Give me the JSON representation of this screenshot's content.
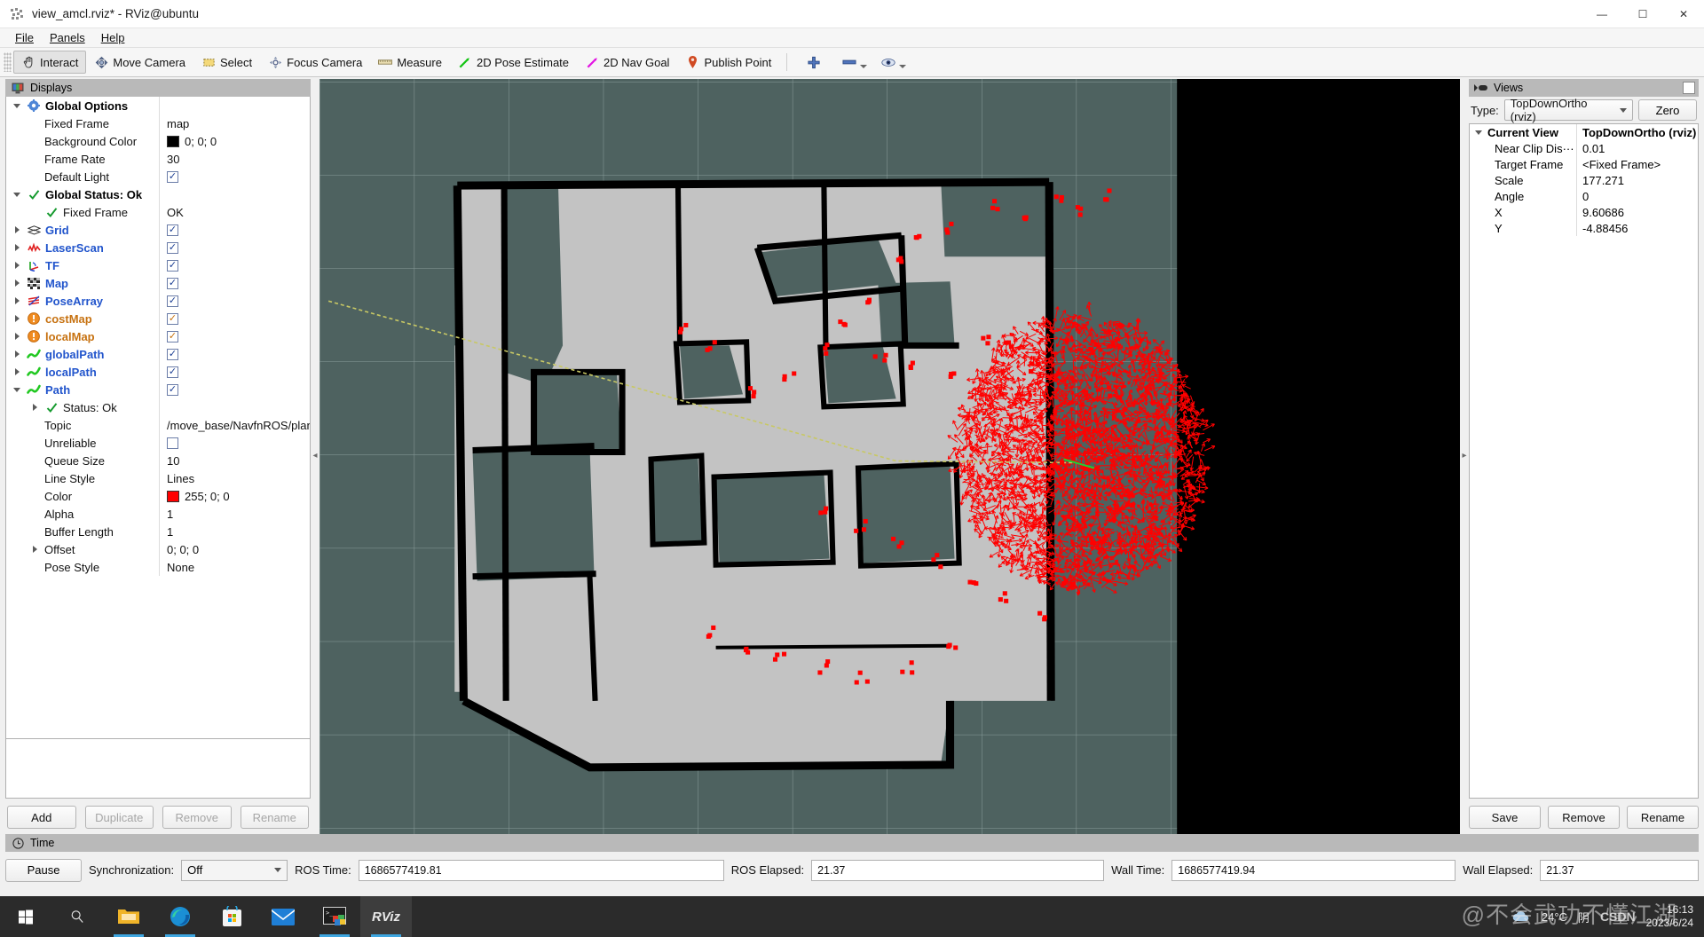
{
  "window": {
    "title": "view_amcl.rviz* - RViz@ubuntu",
    "icon": "rviz-app-icon",
    "minimize": "—",
    "maximize": "☐",
    "close": "✕"
  },
  "menu": {
    "items": [
      "File",
      "Panels",
      "Help"
    ]
  },
  "toolbar": {
    "buttons": [
      {
        "label": "Interact",
        "icon": "hand-cursor-icon",
        "active": true
      },
      {
        "label": "Move Camera",
        "icon": "move-camera-icon",
        "active": false
      },
      {
        "label": "Select",
        "icon": "select-rect-icon",
        "active": false
      },
      {
        "label": "Focus Camera",
        "icon": "focus-camera-icon",
        "active": false
      },
      {
        "label": "Measure",
        "icon": "ruler-icon",
        "active": false
      },
      {
        "label": "2D Pose Estimate",
        "icon": "green-arrow-icon",
        "active": false
      },
      {
        "label": "2D Nav Goal",
        "icon": "magenta-arrow-icon",
        "active": false
      },
      {
        "label": "Publish Point",
        "icon": "map-pin-icon",
        "active": false
      }
    ],
    "extra_icons": [
      "plus-icon",
      "minus-icon",
      "eye-icon"
    ]
  },
  "displays": {
    "title": "Displays",
    "icon": "displays-monitor-icon",
    "rows": [
      {
        "indent": 0,
        "arrow": "open",
        "icon": "gear-icon",
        "label": "Global Options",
        "style": "bold",
        "value_type": "none"
      },
      {
        "indent": 1,
        "arrow": "none",
        "icon": "",
        "label": "Fixed Frame",
        "style": "plain",
        "value_type": "text",
        "value": "map"
      },
      {
        "indent": 1,
        "arrow": "none",
        "icon": "",
        "label": "Background Color",
        "style": "plain",
        "value_type": "color",
        "value": "0; 0; 0",
        "swatch": "#000000"
      },
      {
        "indent": 1,
        "arrow": "none",
        "icon": "",
        "label": "Frame Rate",
        "style": "plain",
        "value_type": "text",
        "value": "30"
      },
      {
        "indent": 1,
        "arrow": "none",
        "icon": "",
        "label": "Default Light",
        "style": "plain",
        "value_type": "check",
        "checked": true
      },
      {
        "indent": 0,
        "arrow": "open",
        "icon": "check-green-icon",
        "label": "Global Status: Ok",
        "style": "bold",
        "value_type": "none"
      },
      {
        "indent": 1,
        "arrow": "none",
        "icon": "check-green-icon",
        "label": "Fixed Frame",
        "style": "plain",
        "value_type": "text",
        "value": "OK"
      },
      {
        "indent": 0,
        "arrow": "closed",
        "icon": "grid-icon",
        "label": "Grid",
        "style": "blue",
        "value_type": "check",
        "checked": true
      },
      {
        "indent": 0,
        "arrow": "closed",
        "icon": "laserscan-icon",
        "label": "LaserScan",
        "style": "blue",
        "value_type": "check",
        "checked": true
      },
      {
        "indent": 0,
        "arrow": "closed",
        "icon": "tf-axes-icon",
        "label": "TF",
        "style": "blue",
        "value_type": "check",
        "checked": true
      },
      {
        "indent": 0,
        "arrow": "closed",
        "icon": "map-grid-icon",
        "label": "Map",
        "style": "blue",
        "value_type": "check",
        "checked": true
      },
      {
        "indent": 0,
        "arrow": "closed",
        "icon": "posearray-icon",
        "label": "PoseArray",
        "style": "blue",
        "value_type": "check",
        "checked": true
      },
      {
        "indent": 0,
        "arrow": "closed",
        "icon": "warning-orange-icon",
        "label": "costMap",
        "style": "orange",
        "value_type": "check",
        "checked": true,
        "check_style": "org"
      },
      {
        "indent": 0,
        "arrow": "closed",
        "icon": "warning-orange-icon",
        "label": "localMap",
        "style": "orange",
        "value_type": "check",
        "checked": true,
        "check_style": "org"
      },
      {
        "indent": 0,
        "arrow": "closed",
        "icon": "path-green-icon",
        "label": "globalPath",
        "style": "blue",
        "value_type": "check",
        "checked": true
      },
      {
        "indent": 0,
        "arrow": "closed",
        "icon": "path-green-icon",
        "label": "localPath",
        "style": "blue",
        "value_type": "check",
        "checked": true
      },
      {
        "indent": 0,
        "arrow": "open",
        "icon": "path-green-icon",
        "label": "Path",
        "style": "blue",
        "value_type": "check",
        "checked": true
      },
      {
        "indent": 1,
        "arrow": "closed",
        "icon": "check-green-icon",
        "label": "Status: Ok",
        "style": "plain",
        "value_type": "none"
      },
      {
        "indent": 1,
        "arrow": "none",
        "icon": "",
        "label": "Topic",
        "style": "plain",
        "value_type": "text",
        "value": "/move_base/NavfnROS/plan"
      },
      {
        "indent": 1,
        "arrow": "none",
        "icon": "",
        "label": "Unreliable",
        "style": "plain",
        "value_type": "check",
        "checked": false
      },
      {
        "indent": 1,
        "arrow": "none",
        "icon": "",
        "label": "Queue Size",
        "style": "plain",
        "value_type": "text",
        "value": "10"
      },
      {
        "indent": 1,
        "arrow": "none",
        "icon": "",
        "label": "Line Style",
        "style": "plain",
        "value_type": "text",
        "value": "Lines"
      },
      {
        "indent": 1,
        "arrow": "none",
        "icon": "",
        "label": "Color",
        "style": "plain",
        "value_type": "color",
        "value": "255; 0; 0",
        "swatch": "#ff0000"
      },
      {
        "indent": 1,
        "arrow": "none",
        "icon": "",
        "label": "Alpha",
        "style": "plain",
        "value_type": "text",
        "value": "1"
      },
      {
        "indent": 1,
        "arrow": "none",
        "icon": "",
        "label": "Buffer Length",
        "style": "plain",
        "value_type": "text",
        "value": "1"
      },
      {
        "indent": 1,
        "arrow": "closed",
        "icon": "",
        "label": "Offset",
        "style": "plain",
        "value_type": "text",
        "value": "0; 0; 0"
      },
      {
        "indent": 1,
        "arrow": "none",
        "icon": "",
        "label": "Pose Style",
        "style": "plain",
        "value_type": "text",
        "value": "None"
      }
    ],
    "buttons": [
      {
        "label": "Add",
        "enabled": true
      },
      {
        "label": "Duplicate",
        "enabled": false
      },
      {
        "label": "Remove",
        "enabled": false
      },
      {
        "label": "Rename",
        "enabled": false
      }
    ]
  },
  "views": {
    "title": "Views",
    "icon": "views-panel-icon",
    "type_label": "Type:",
    "type_value": "TopDownOrtho (rviz)",
    "zero_label": "Zero",
    "rows": [
      {
        "name": "Current View",
        "value": "TopDownOrtho (rviz)",
        "bold": true,
        "arrow": "open",
        "indent": 0
      },
      {
        "name": "Near Clip Dis···",
        "value": "0.01",
        "bold": false,
        "arrow": "none",
        "indent": 1
      },
      {
        "name": "Target Frame",
        "value": "<Fixed Frame>",
        "bold": false,
        "arrow": "none",
        "indent": 1
      },
      {
        "name": "Scale",
        "value": "177.271",
        "bold": false,
        "arrow": "none",
        "indent": 1
      },
      {
        "name": "Angle",
        "value": "0",
        "bold": false,
        "arrow": "none",
        "indent": 1
      },
      {
        "name": "X",
        "value": "9.60686",
        "bold": false,
        "arrow": "none",
        "indent": 1
      },
      {
        "name": "Y",
        "value": "-4.88456",
        "bold": false,
        "arrow": "none",
        "indent": 1
      }
    ],
    "buttons": [
      {
        "label": "Save"
      },
      {
        "label": "Remove"
      },
      {
        "label": "Rename"
      }
    ]
  },
  "time": {
    "title": "Time",
    "icon": "clock-icon",
    "pause_label": "Pause",
    "sync_label": "Synchronization:",
    "sync_value": "Off",
    "fields": [
      {
        "label": "ROS Time:",
        "value": "1686577419.81"
      },
      {
        "label": "ROS Elapsed:",
        "value": "21.37"
      },
      {
        "label": "Wall Time:",
        "value": "1686577419.94"
      },
      {
        "label": "Wall Elapsed:",
        "value": "21.37"
      }
    ]
  },
  "taskbar": {
    "items": [
      {
        "name": "start-button",
        "icon": "windows-logo-icon",
        "active": false,
        "underline": false
      },
      {
        "name": "search-button",
        "icon": "search-icon",
        "active": false,
        "underline": false
      },
      {
        "name": "file-explorer",
        "icon": "folder-icon",
        "active": false,
        "underline": true
      },
      {
        "name": "edge-browser",
        "icon": "edge-icon",
        "active": false,
        "underline": true
      },
      {
        "name": "microsoft-store",
        "icon": "store-icon",
        "active": false,
        "underline": false
      },
      {
        "name": "mail-app",
        "icon": "mail-icon",
        "active": false,
        "underline": false
      },
      {
        "name": "terminal-app",
        "icon": "terminal-icon",
        "active": false,
        "underline": true
      },
      {
        "name": "rviz-app",
        "icon": "rviz-icon",
        "active": true,
        "underline": true,
        "label": "RViz"
      }
    ],
    "weather": {
      "temp": "24°C",
      "condition": "阴",
      "icon": "cloud-icon"
    },
    "csdn": "CSDN",
    "watermark": "@不会武功不懂江湖",
    "clock_time": "16:13",
    "clock_date": "2023/6/24"
  },
  "render_view": {
    "background_color": "#000000",
    "grid_color": "#4e6260",
    "map_free_color": "#c0c0c0",
    "map_occupied_color": "#000000",
    "map_unknown_color": "#4e6260",
    "particle_color": "#ff0000",
    "path_color": "#c8c864"
  },
  "colors": {
    "panel_header": "#b9b9b9",
    "accent_blue": "#2255cc",
    "accent_orange": "#c77211",
    "taskbar": "#2b2b2b"
  }
}
